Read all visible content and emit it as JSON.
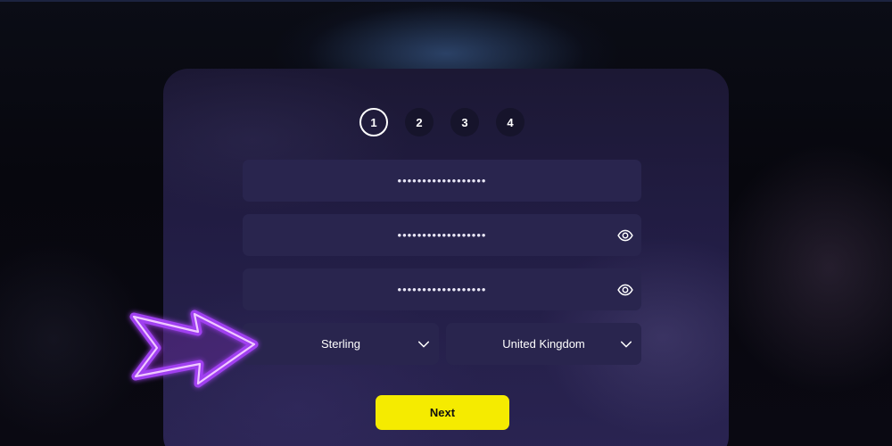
{
  "steps": [
    "1",
    "2",
    "3",
    "4"
  ],
  "active_step": "1",
  "form": {
    "field1_value": "••••••••••••••••••",
    "field2_value": "••••••••••••••••••",
    "field3_value": "••••••••••••••••••",
    "currency": "Sterling",
    "country": "United Kingdom"
  },
  "next_label": "Next",
  "icons": {
    "password_toggle": "eye-icon",
    "dropdown": "chevron-down-icon",
    "pointer": "neon-arrow"
  },
  "colors": {
    "accent": "#f5eb00",
    "card": "#221d45",
    "field": "#29254e",
    "neon_arrow": "#b14bff"
  }
}
